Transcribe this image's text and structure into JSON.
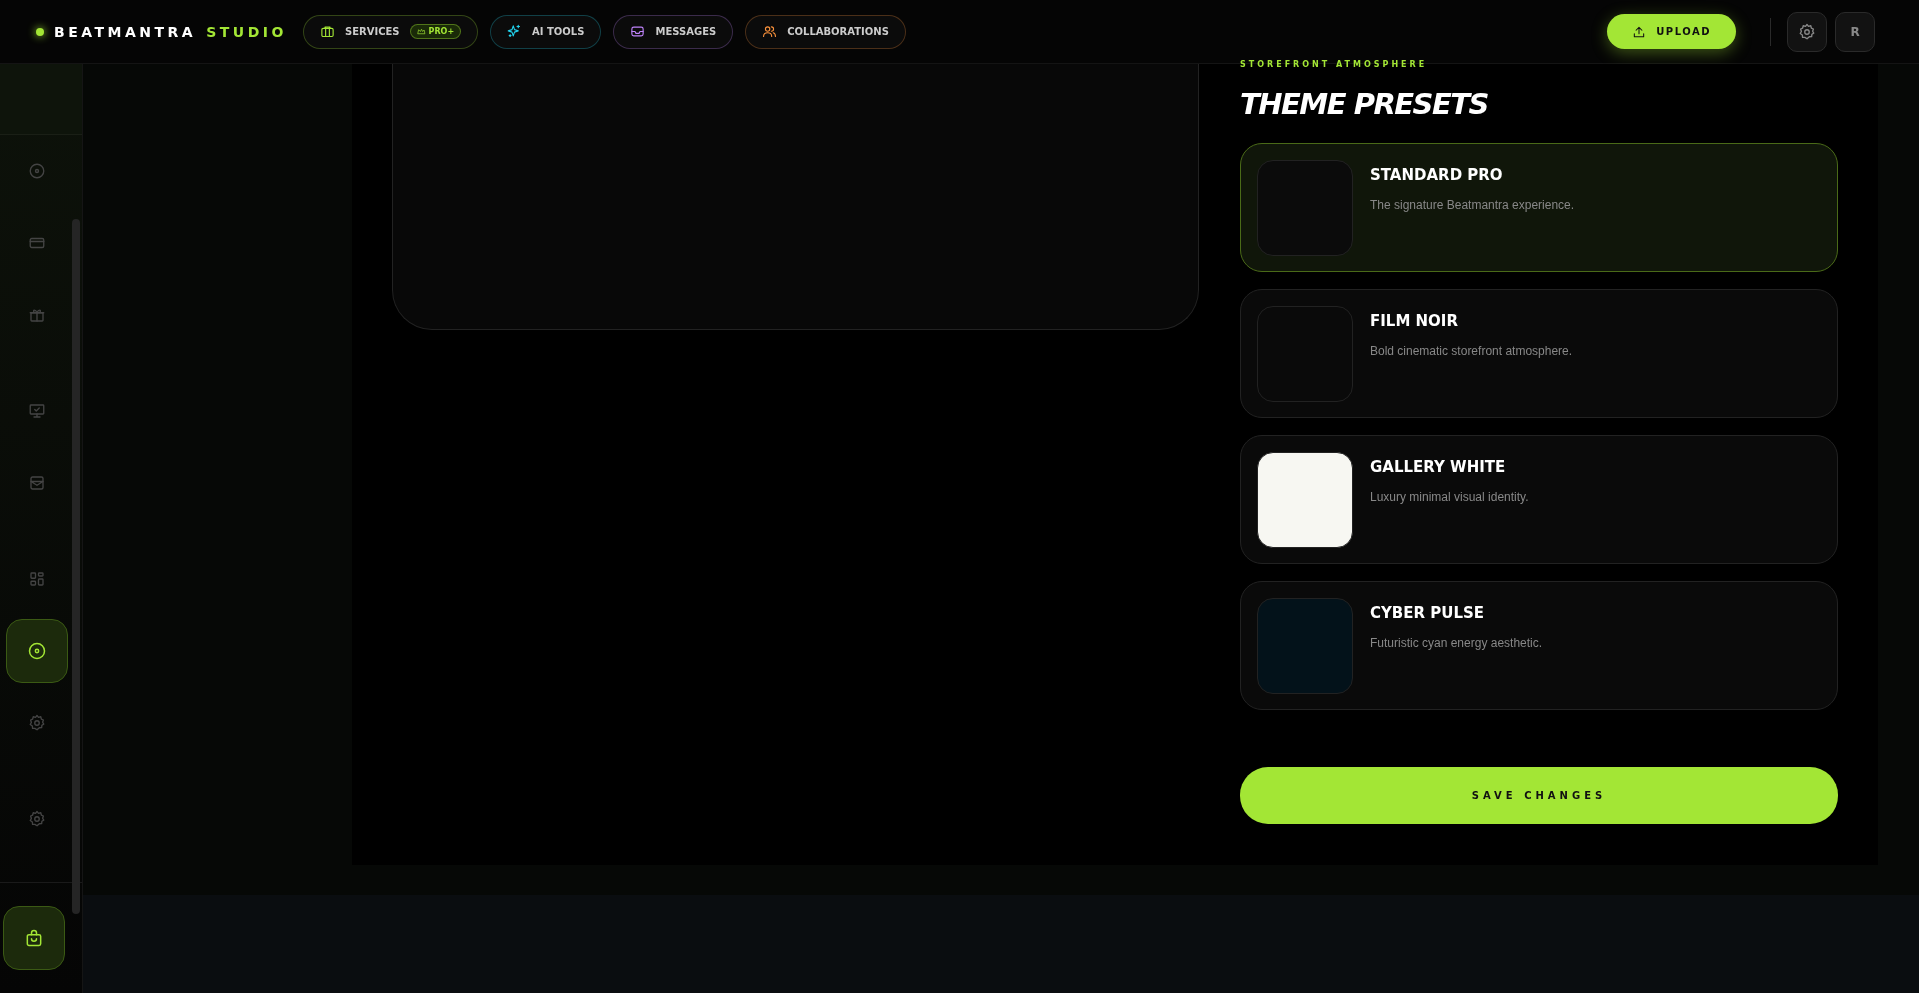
{
  "brand": {
    "name": "BEATMANTRA",
    "accent": "STUDIO"
  },
  "nav": [
    {
      "label": "SERVICES",
      "kind": "briefcase",
      "color": "#a3e635",
      "badge": "PRO+"
    },
    {
      "label": "AI TOOLS",
      "kind": "sparkle",
      "color": "#22d3ee"
    },
    {
      "label": "MESSAGES",
      "kind": "inbox",
      "color": "#c084fc"
    },
    {
      "label": "COLLABORATIONS",
      "kind": "users",
      "color": "#fb923c"
    }
  ],
  "upload_button": "UPLOAD",
  "avatar": "R",
  "sidebar": {
    "items": [
      {
        "kind": "disc",
        "selected": false
      },
      {
        "kind": "card",
        "selected": false
      },
      {
        "kind": "gift",
        "selected": false
      },
      {
        "kind": "monitor",
        "selected": false
      },
      {
        "kind": "archive",
        "selected": false
      },
      {
        "kind": "grid",
        "selected": false
      },
      {
        "kind": "disc",
        "selected": true
      },
      {
        "kind": "gear",
        "selected": false
      },
      {
        "kind": "gear",
        "selected": false
      }
    ],
    "footer_item": {
      "kind": "bag",
      "selected": true
    }
  },
  "section": {
    "eyebrow": "STOREFRONT ATMOSPHERE",
    "title": "THEME PRESETS",
    "presets": [
      {
        "name": "STANDARD PRO",
        "description": "The signature Beatmantra experience.",
        "color": "#0b0b0b",
        "selected": true
      },
      {
        "name": "FILM NOIR",
        "description": "Bold cinematic storefront atmosphere.",
        "color": "#0a0a0a",
        "selected": false
      },
      {
        "name": "GALLERY WHITE",
        "description": "Luxury minimal visual identity.",
        "color": "#f7f7f2",
        "selected": false
      },
      {
        "name": "CYBER PULSE",
        "description": "Futuristic cyan energy aesthetic.",
        "color": "#03121a",
        "selected": false
      }
    ],
    "save_button": "SAVE CHANGES"
  }
}
